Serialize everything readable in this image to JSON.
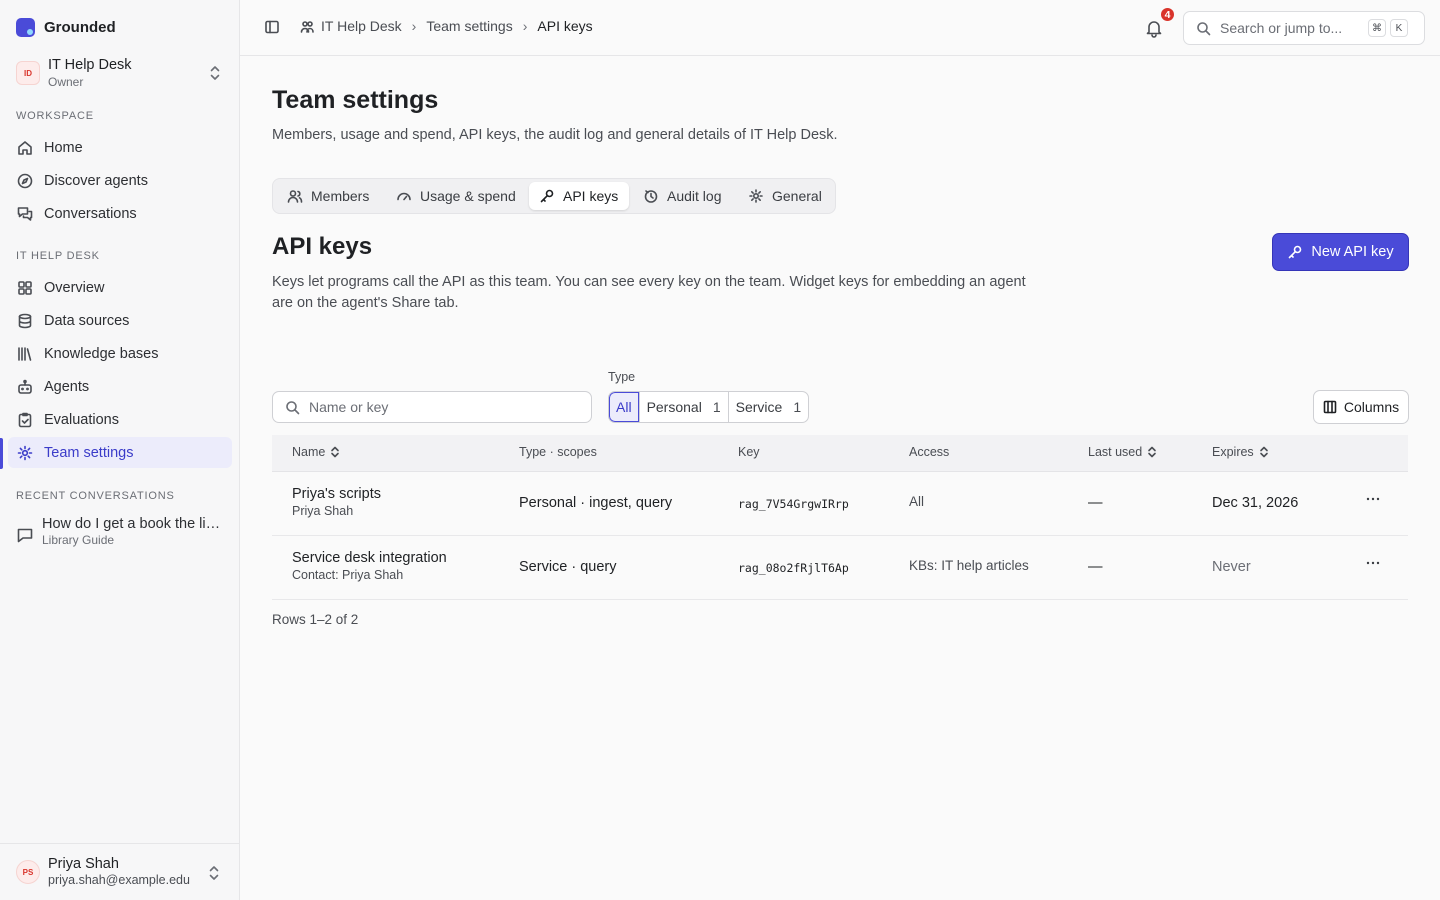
{
  "brand": {
    "name": "Grounded"
  },
  "team_switcher": {
    "initials": "ID",
    "name": "IT Help Desk",
    "role": "Owner"
  },
  "sidebar": {
    "workspace_label": "WORKSPACE",
    "workspace_items": [
      {
        "label": "Home",
        "icon": "home-icon"
      },
      {
        "label": "Discover agents",
        "icon": "compass-icon"
      },
      {
        "label": "Conversations",
        "icon": "chat-bubbles-icon"
      }
    ],
    "team_label": "IT HELP DESK",
    "team_items": [
      {
        "label": "Overview",
        "icon": "grid-icon"
      },
      {
        "label": "Data sources",
        "icon": "database-icon"
      },
      {
        "label": "Knowledge bases",
        "icon": "library-icon"
      },
      {
        "label": "Agents",
        "icon": "bot-icon"
      },
      {
        "label": "Evaluations",
        "icon": "clipboard-check-icon"
      },
      {
        "label": "Team settings",
        "icon": "gear-icon",
        "active": true
      }
    ],
    "recent_label": "RECENT CONVERSATIONS",
    "recent": [
      {
        "title": "How do I get a book the library doesn't have?",
        "subtitle": "Library Guide"
      }
    ]
  },
  "user": {
    "initials": "PS",
    "name": "Priya Shah",
    "email": "priya.shah@example.edu"
  },
  "topbar": {
    "breadcrumbs": [
      "IT Help Desk",
      "Team settings",
      "API keys"
    ],
    "notifications_count": "4",
    "search_placeholder": "Search or jump to...",
    "shortcut_keys": [
      "⌘",
      "K"
    ]
  },
  "page": {
    "title": "Team settings",
    "description": "Members, usage and spend, API keys, the audit log and general details of IT Help Desk.",
    "tabs": [
      {
        "label": "Members",
        "icon": "users-icon"
      },
      {
        "label": "Usage & spend",
        "icon": "gauge-icon"
      },
      {
        "label": "API keys",
        "icon": "key-icon",
        "active": true
      },
      {
        "label": "Audit log",
        "icon": "audit-icon"
      },
      {
        "label": "General",
        "icon": "gear-icon"
      }
    ]
  },
  "api_keys": {
    "title": "API keys",
    "description": "Keys let programs call the API as this team. You can see every key on the team. Widget keys for embedding an agent are on the agent's Share tab.",
    "new_button": "New API key",
    "filter_placeholder": "Name or key",
    "type_filter": {
      "label": "Type",
      "options": [
        {
          "label": "All",
          "count": "",
          "active": true
        },
        {
          "label": "Personal",
          "count": "1"
        },
        {
          "label": "Service",
          "count": "1"
        }
      ]
    },
    "columns_button": "Columns",
    "table": {
      "headers": {
        "name": "Name",
        "type": "Type · scopes",
        "key": "Key",
        "access": "Access",
        "last_used": "Last used",
        "expires": "Expires"
      },
      "rows": [
        {
          "name": "Priya's scripts",
          "subtitle": "Priya Shah",
          "type": "Personal · ingest, query",
          "key": "rag_7V54GrgwIRrp",
          "access": "All",
          "last_used": "—",
          "expires": "Dec 31, 2026"
        },
        {
          "name": "Service desk integration",
          "subtitle": "Contact: Priya Shah",
          "type": "Service · query",
          "key": "rag_08o2fRjlT6Ap",
          "access": "KBs: IT help articles",
          "last_used": "—",
          "expires": "Never"
        }
      ]
    },
    "rows_info": "Rows 1–2 of 2"
  },
  "colors": {
    "accent": "#4a4bd8",
    "badge": "#d9342b",
    "active_bg": "#ececfb"
  }
}
